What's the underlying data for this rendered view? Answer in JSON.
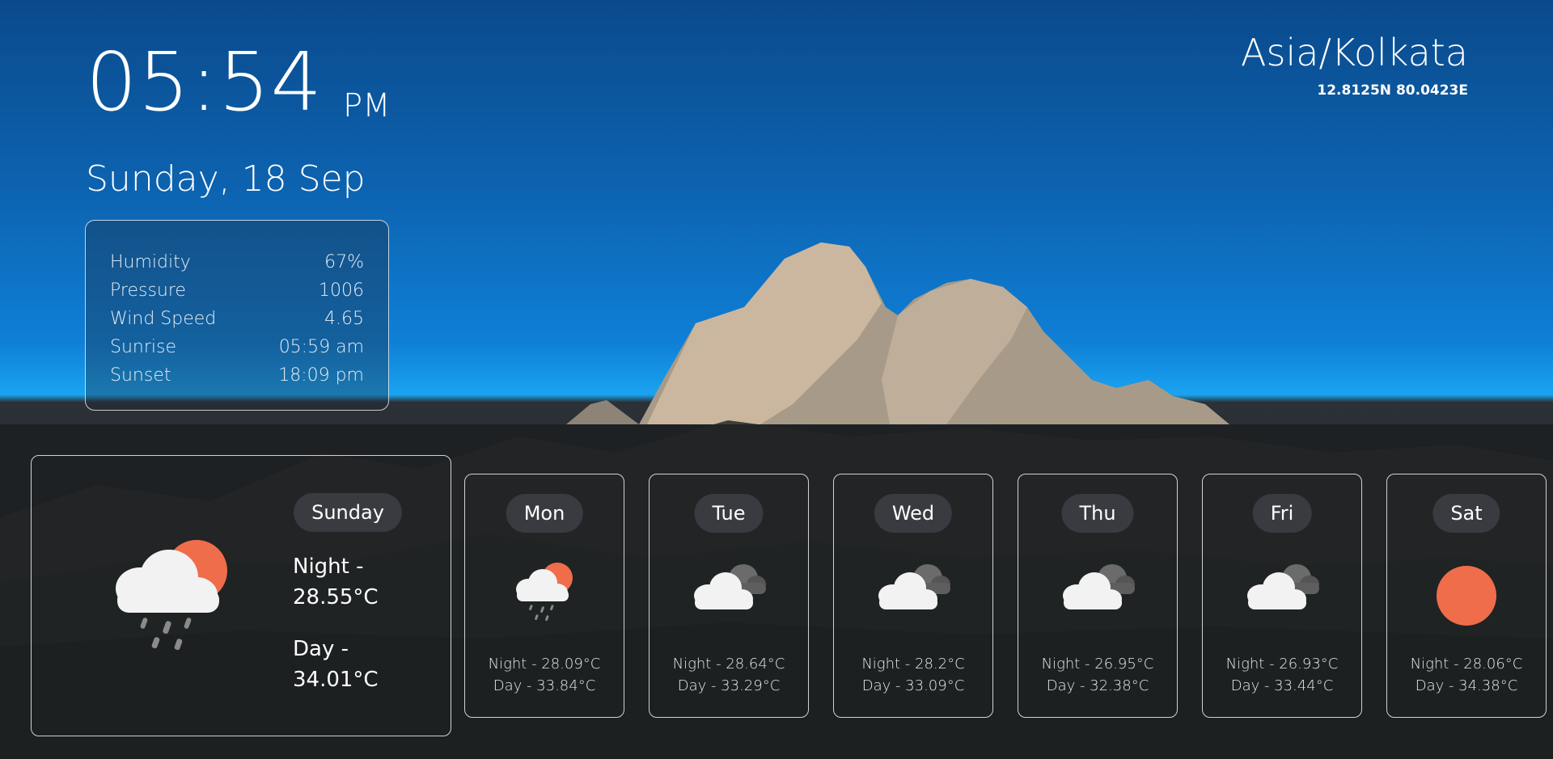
{
  "clock": {
    "time": "05:54",
    "ampm": "PM"
  },
  "date": "Sunday, 18 Sep",
  "location": {
    "timezone": "Asia/Kolkata",
    "coords": "12.8125N 80.0423E"
  },
  "details": [
    {
      "label": "Humidity",
      "value": "67%"
    },
    {
      "label": "Pressure",
      "value": "1006"
    },
    {
      "label": "Wind Speed",
      "value": "4.65"
    },
    {
      "label": "Sunrise",
      "value": "05:59 am"
    },
    {
      "label": "Sunset",
      "value": "18:09 pm"
    }
  ],
  "today": {
    "day": "Sunday",
    "night_label": "Night -",
    "night_temp": "28.55°C",
    "day_label": "Day -",
    "day_temp": "34.01°C",
    "icon": "rain-cloud-sun-icon"
  },
  "forecast": [
    {
      "day": "Mon",
      "night": "Night - 28.09°C",
      "day_temp": "Day - 33.84°C",
      "icon": "rain-cloud-sun-icon"
    },
    {
      "day": "Tue",
      "night": "Night - 28.64°C",
      "day_temp": "Day - 33.29°C",
      "icon": "clouds-icon"
    },
    {
      "day": "Wed",
      "night": "Night - 28.2°C",
      "day_temp": "Day - 33.09°C",
      "icon": "clouds-icon"
    },
    {
      "day": "Thu",
      "night": "Night - 26.95°C",
      "day_temp": "Day - 32.38°C",
      "icon": "clouds-icon"
    },
    {
      "day": "Fri",
      "night": "Night - 26.93°C",
      "day_temp": "Day - 33.44°C",
      "icon": "clouds-icon"
    },
    {
      "day": "Sat",
      "night": "Night - 28.06°C",
      "day_temp": "Day - 34.38°C",
      "icon": "sun-icon"
    }
  ],
  "colors": {
    "sun": "#ef6d4a",
    "cloud": "#f2f2f2",
    "dark_cloud": "#6b6b6b",
    "pill": "#3a3b40"
  }
}
